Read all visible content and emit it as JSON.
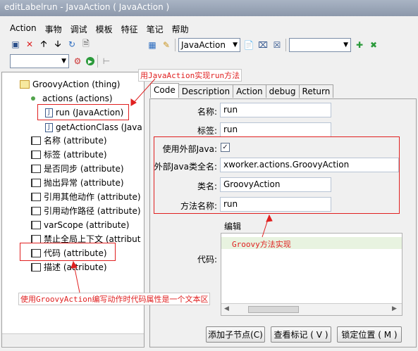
{
  "window": {
    "title": "editLabelrun - JavaAction ( JavaAction )"
  },
  "menu": [
    "Action",
    "事物",
    "调试",
    "模板",
    "特征",
    "笔记",
    "帮助"
  ],
  "toolbar": {
    "java_combo": "JavaAction",
    "empty_combo": "",
    "small_combo": ""
  },
  "tree": {
    "root": "GroovyAction (thing)",
    "actions": "actions (actions)",
    "run": "run (JavaAction)",
    "getActionClass": "getActionClass (Java",
    "attrs": [
      "名称 (attribute)",
      "标签 (attribute)",
      "是否同步 (attribute)",
      "抛出异常 (attribute)",
      "引用其他动作 (attribute)",
      "引用动作路径 (attribute)",
      "varScope (attribute)",
      "禁止全局上下文 (attribut",
      "代码 (attribute)",
      "描述 (attribute)"
    ]
  },
  "tabs": [
    "Code",
    "Description",
    "Action",
    "debug",
    "Return"
  ],
  "form": {
    "name_label": "名称:",
    "name_value": "run",
    "label_label": "标签:",
    "label_value": "run",
    "use_external_label": "使用外部Java:",
    "use_external_checked": "✓",
    "external_class_label": "外部Java类全名:",
    "external_class_value": "xworker.actions.GroovyAction",
    "class_name_label": "类名:",
    "class_name_value": "GroovyAction",
    "method_label": "方法名称:",
    "method_value": "run",
    "editor_header": "编辑",
    "code_label": "代码:"
  },
  "buttons": {
    "add_child": "添加子节点(C)",
    "view_mark": "查看标记 ( V )",
    "lock_pos": "锁定位置 ( M )"
  },
  "annotations": {
    "top": "用JavaAction实现run方法",
    "middle": "Groovy方法实现",
    "bottom": "使用GroovyAction编写动作时代码属性是一个文本区"
  },
  "colors": {
    "annotation": "#e02020",
    "title_bg": "#8c98ab"
  }
}
